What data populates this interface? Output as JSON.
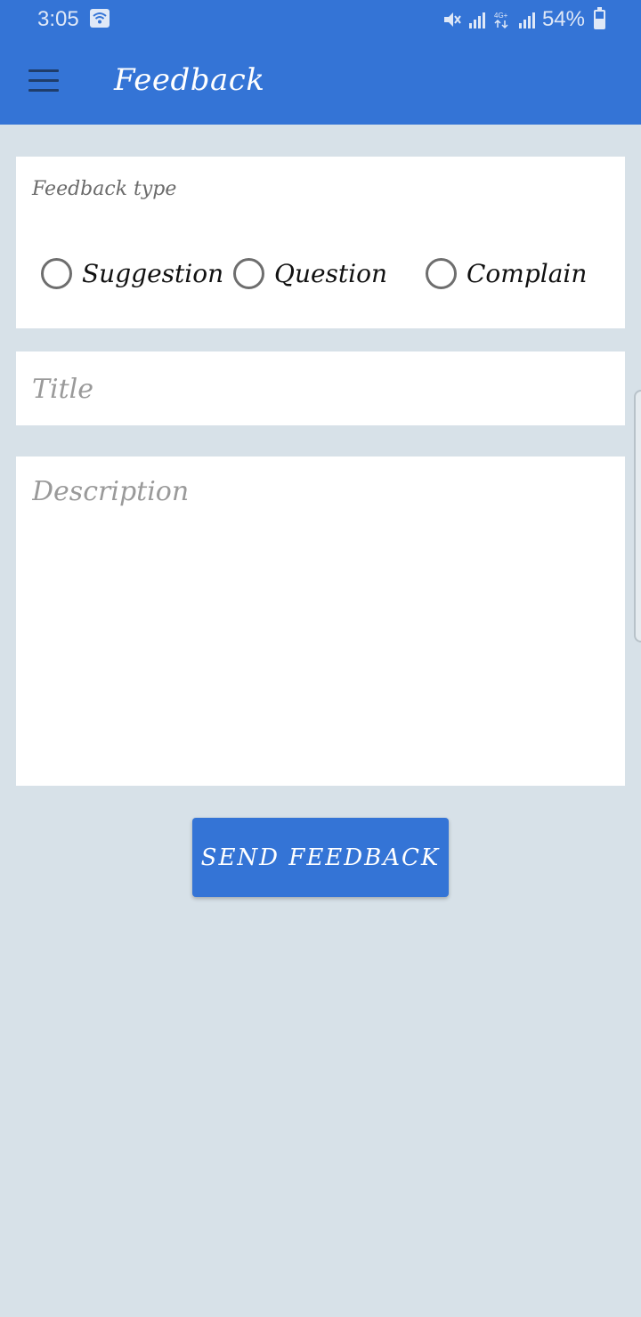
{
  "status_bar": {
    "time": "3:05",
    "battery_text": "54%",
    "battery_level": 0.54,
    "icons": [
      "wifi-icon",
      "mute-icon",
      "signal-icon",
      "4g-icon",
      "signal-icon",
      "battery-icon"
    ]
  },
  "app_bar": {
    "title": "Feedback",
    "menu_icon": "hamburger-menu-icon"
  },
  "feedback_type": {
    "label": "Feedback type",
    "options": [
      "Suggestion",
      "Question",
      "Complain"
    ],
    "selected": null
  },
  "title_field": {
    "placeholder": "Title",
    "value": ""
  },
  "description_field": {
    "placeholder": "Description",
    "value": ""
  },
  "send_button": {
    "label": "SEND FEEDBACK"
  },
  "colors": {
    "primary": "#3474d6",
    "background": "#d7e1e8",
    "card": "#ffffff"
  }
}
